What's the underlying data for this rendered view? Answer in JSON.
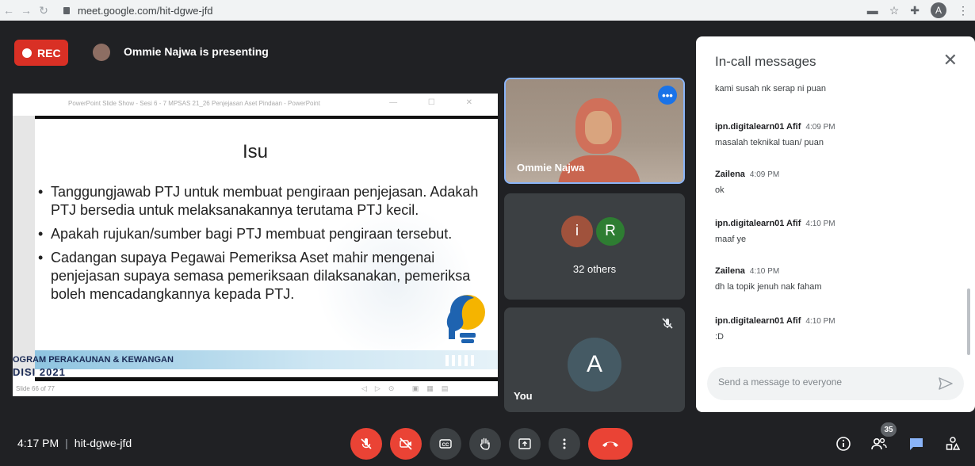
{
  "browser": {
    "url": "meet.google.com/hit-dgwe-jfd",
    "profile_initial": "A"
  },
  "header": {
    "rec_label": "REC",
    "presenting_text": "Ommie Najwa is presenting"
  },
  "slide": {
    "titlebar": "PowerPoint Slide Show  -  Sesi 6 - 7 MPSAS 21_26 Penjejasan Aset Pindaan - PowerPoint",
    "heading": "Isu",
    "bullets": [
      "Tanggungjawab PTJ untuk membuat pengiraan penjejasan. Adakah PTJ bersedia untuk melaksanakannya terutama PTJ kecil.",
      "Apakah rujukan/sumber bagi PTJ membuat pengiraan tersebut.",
      "Cadangan supaya Pegawai Pemeriksa Aset mahir mengenai penjejasan supaya semasa pemeriksaan dilaksanakan, pemeriksa boleh mencadangkannya kepada PTJ."
    ],
    "footer_text": "OGRAM PERAKAUNAN & KEWANGAN",
    "footer_year": "DISI 2021",
    "status_text": "Slide 66 of 77"
  },
  "tiles": {
    "presenter_name": "Ommie Najwa",
    "group_initials": [
      "i",
      "R"
    ],
    "others_label": "32 others",
    "self_initial": "A",
    "self_label": "You"
  },
  "chat": {
    "title": "In-call messages",
    "first_message": "kami susah nk serap ni puan",
    "messages": [
      {
        "sender": "ipn.digitalearn01 Afif",
        "time": "4:09 PM",
        "text": "masalah teknikal tuan/ puan"
      },
      {
        "sender": "Zailena",
        "time": "4:09 PM",
        "text": "ok"
      },
      {
        "sender": "ipn.digitalearn01 Afif",
        "time": "4:10 PM",
        "text": "maaf ye"
      },
      {
        "sender": "Zailena",
        "time": "4:10 PM",
        "text": "dh la topik jenuh nak faham"
      },
      {
        "sender": "ipn.digitalearn01 Afif",
        "time": "4:10 PM",
        "text": ":D"
      }
    ],
    "input_placeholder": "Send a message to everyone"
  },
  "bottom": {
    "time": "4:17 PM",
    "meeting_code": "hit-dgwe-jfd",
    "people_count": "35",
    "controls": [
      "mic-off-icon",
      "camera-off-icon",
      "captions-icon",
      "raise-hand-icon",
      "present-icon",
      "more-icon",
      "end-call-icon"
    ]
  },
  "colors": {
    "background": "#202124",
    "rec_red": "#d93025",
    "control_red": "#ea4335",
    "accent_blue": "#1a73e8",
    "tile_gray": "#3c4043"
  }
}
